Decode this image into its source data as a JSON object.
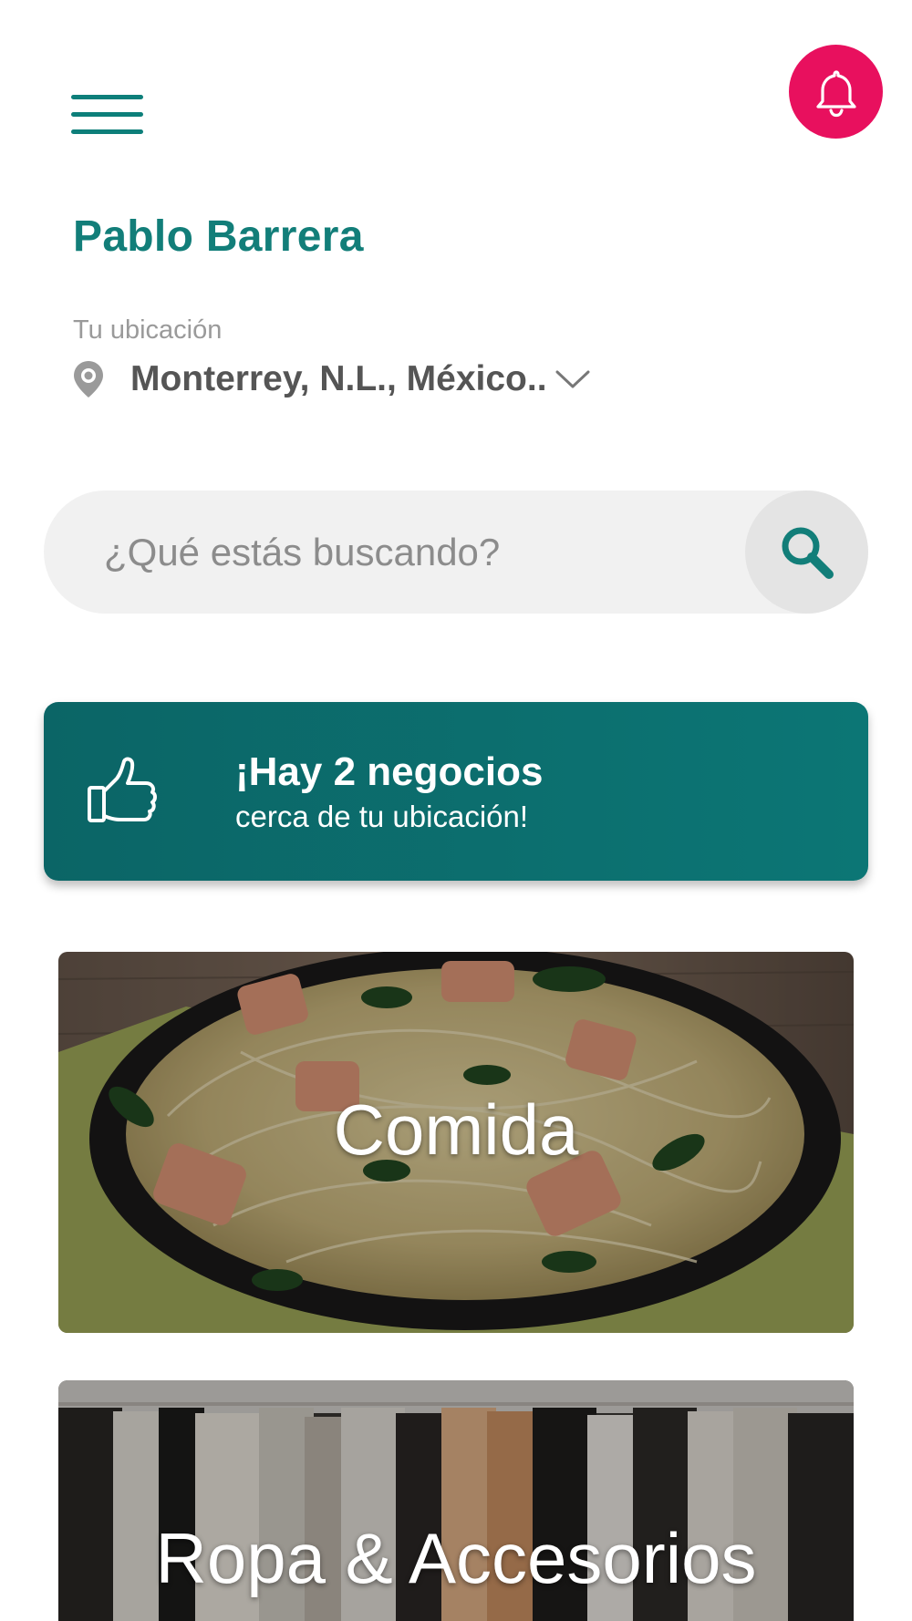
{
  "header": {
    "menu_icon": "hamburger-menu-icon",
    "notification_icon": "bell-icon",
    "accent_color": "#127e79",
    "notification_color": "#e8105e"
  },
  "user": {
    "name": "Pablo Barrera"
  },
  "location": {
    "label": "Tu ubicación",
    "value": "Monterrey, N.L., México..",
    "pin_icon": "map-pin-icon",
    "dropdown_icon": "chevron-down-icon"
  },
  "search": {
    "placeholder": "¿Qué estás buscando?",
    "icon": "search-icon"
  },
  "banner": {
    "title": "¡Hay 2 negocios",
    "subtitle": "cerca de tu ubicación!",
    "icon": "thumbs-up-icon",
    "color": "#0b6a6a"
  },
  "categories": [
    {
      "label": "Comida"
    },
    {
      "label": "Ropa & Accesorios"
    }
  ]
}
